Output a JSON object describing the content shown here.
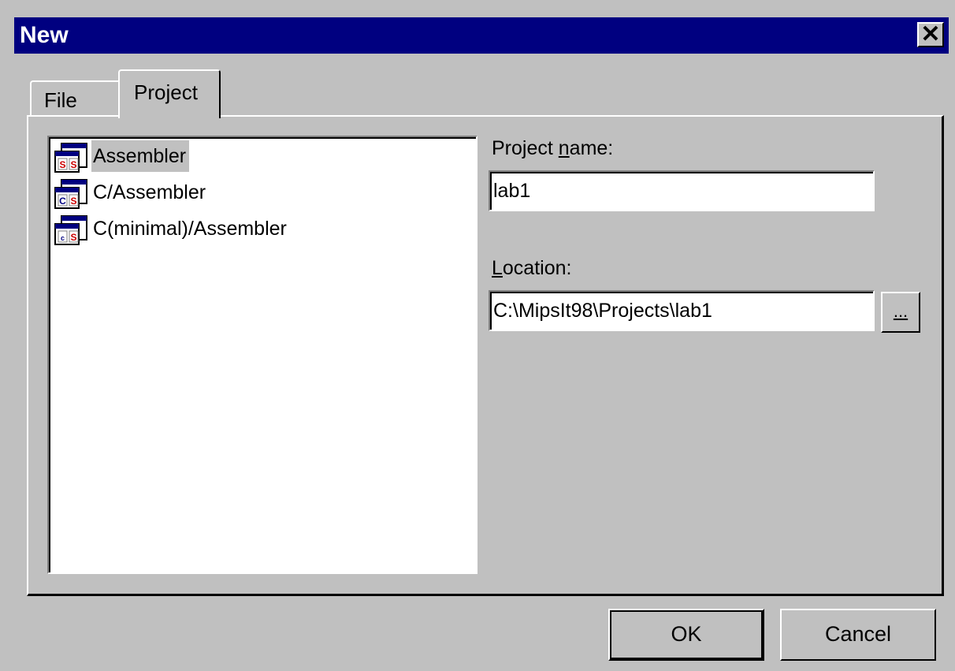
{
  "window": {
    "title": "New",
    "close_glyph": "✕"
  },
  "tabs": [
    {
      "label": "File"
    },
    {
      "label": "Project",
      "selected": true
    }
  ],
  "project_types": [
    {
      "label": "Assembler",
      "icon": "project-assembler-icon",
      "selected": true
    },
    {
      "label": "C/Assembler",
      "icon": "project-c-assembler-icon"
    },
    {
      "label": "C(minimal)/Assembler",
      "icon": "project-c-minimal-assembler-icon"
    }
  ],
  "project_name": {
    "label_pre": "Project ",
    "label_mnemonic": "n",
    "label_post": "ame:",
    "value": "lab1"
  },
  "location": {
    "label_mnemonic": "L",
    "label_post": "ocation:",
    "value": "C:\\MipsIt98\\Projects\\lab1",
    "browse_label": "..."
  },
  "buttons": {
    "ok": "OK",
    "cancel": "Cancel"
  },
  "colors": {
    "titlebar": "#000080",
    "face": "#c0c0c0",
    "selection": "#c0c0c0"
  }
}
